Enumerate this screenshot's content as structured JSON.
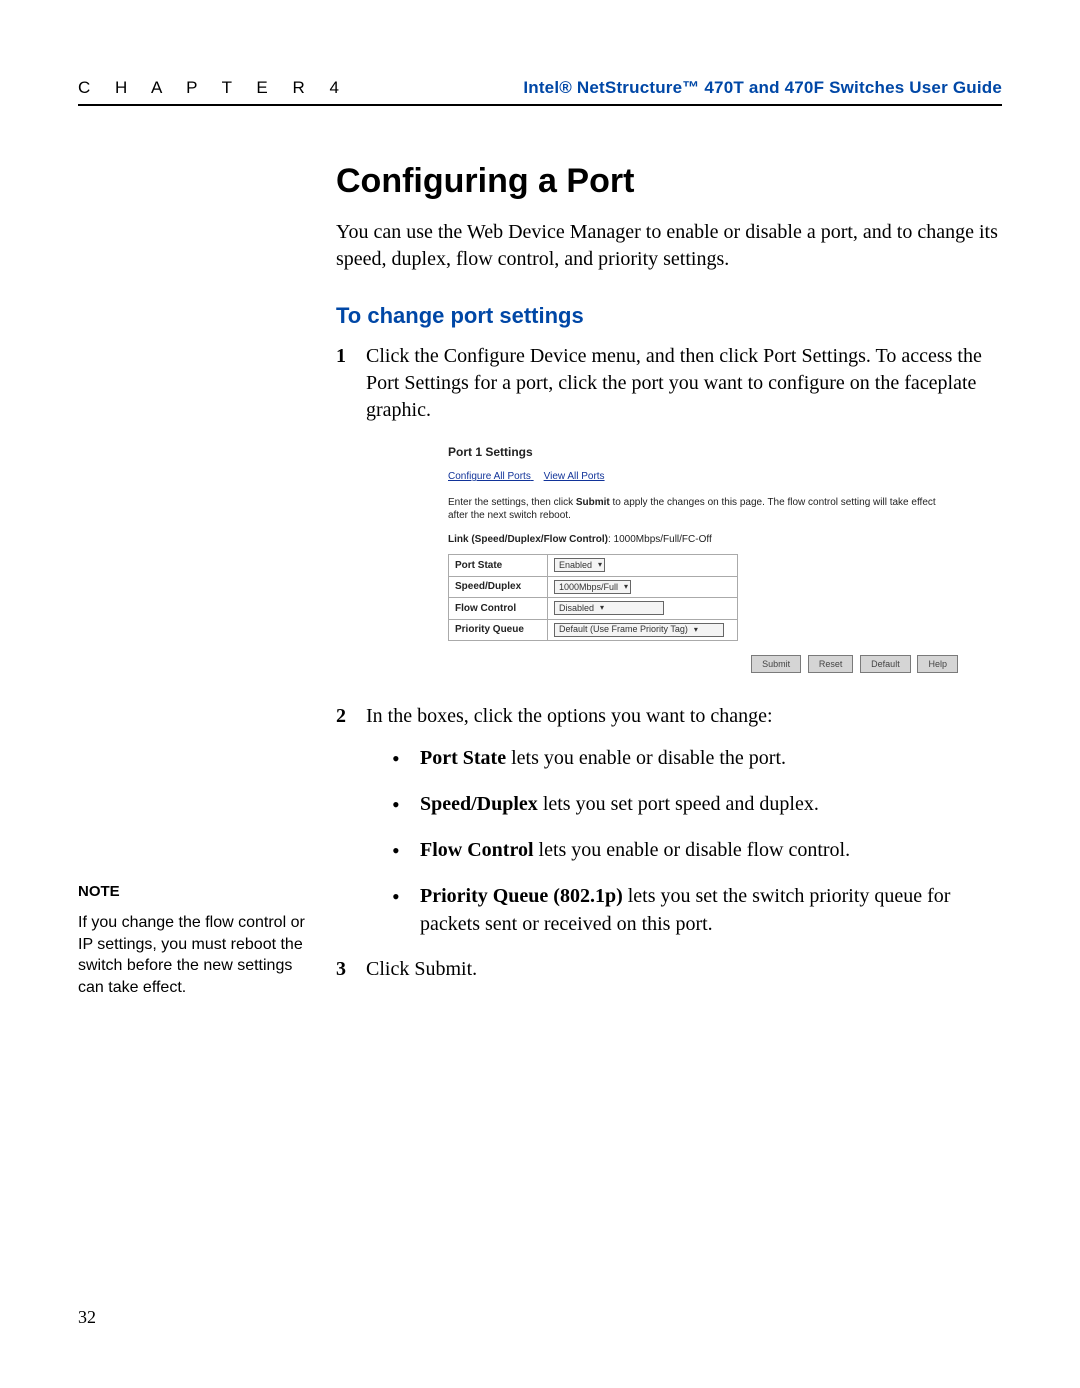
{
  "header": {
    "chapter_label": "C   H   A   P   T   E   R       4",
    "guide_title": "Intel® NetStructure™ 470T and 470F Switches User Guide"
  },
  "page_number": "32",
  "title": "Configuring a Port",
  "intro": "You can use the Web Device Manager to enable or disable a port, and to change its speed, duplex, flow control, and priority settings.",
  "subheading": "To change port settings",
  "steps": {
    "s1": "Click the Configure Device menu, and then click Port Settings. To access the Port Settings for a port, click the port you want to configure on the faceplate graphic.",
    "s2_lead": "In the boxes, click the options you want to change:",
    "b1_term": "Port State",
    "b1_rest": " lets you enable or disable the port.",
    "b2_term": "Speed/Duplex",
    "b2_rest": " lets you set port speed and duplex.",
    "b3_term": "Flow Control",
    "b3_rest": " lets you enable or disable flow control.",
    "b4_term": "Priority Queue (802.1p)",
    "b4_rest": " lets you set the switch priority queue for packets sent or received on this port.",
    "s3": "Click Submit."
  },
  "note": {
    "heading": "NOTE",
    "body": "If you change the flow control or IP settings, you must reboot the switch before the new settings can take effect."
  },
  "shot": {
    "title": "Port 1 Settings",
    "link1": "Configure All Ports",
    "link2": "View All Ports",
    "instr_pre": "Enter the settings, then click ",
    "instr_bold": "Submit",
    "instr_post": " to apply the changes on this page. The flow control setting will take effect after the next switch reboot.",
    "link_lbl": "Link (Speed/Duplex/Flow Control)",
    "link_val": ": 1000Mbps/Full/FC-Off",
    "rows": {
      "r1_lbl": "Port State",
      "r1_val": "Enabled",
      "r2_lbl": "Speed/Duplex",
      "r2_val": "1000Mbps/Full",
      "r3_lbl": "Flow Control",
      "r3_val": "Disabled",
      "r4_lbl": "Priority Queue",
      "r4_val": "Default (Use Frame Priority Tag)"
    },
    "buttons": {
      "submit": "Submit",
      "reset": "Reset",
      "default": "Default",
      "help": "Help"
    }
  }
}
